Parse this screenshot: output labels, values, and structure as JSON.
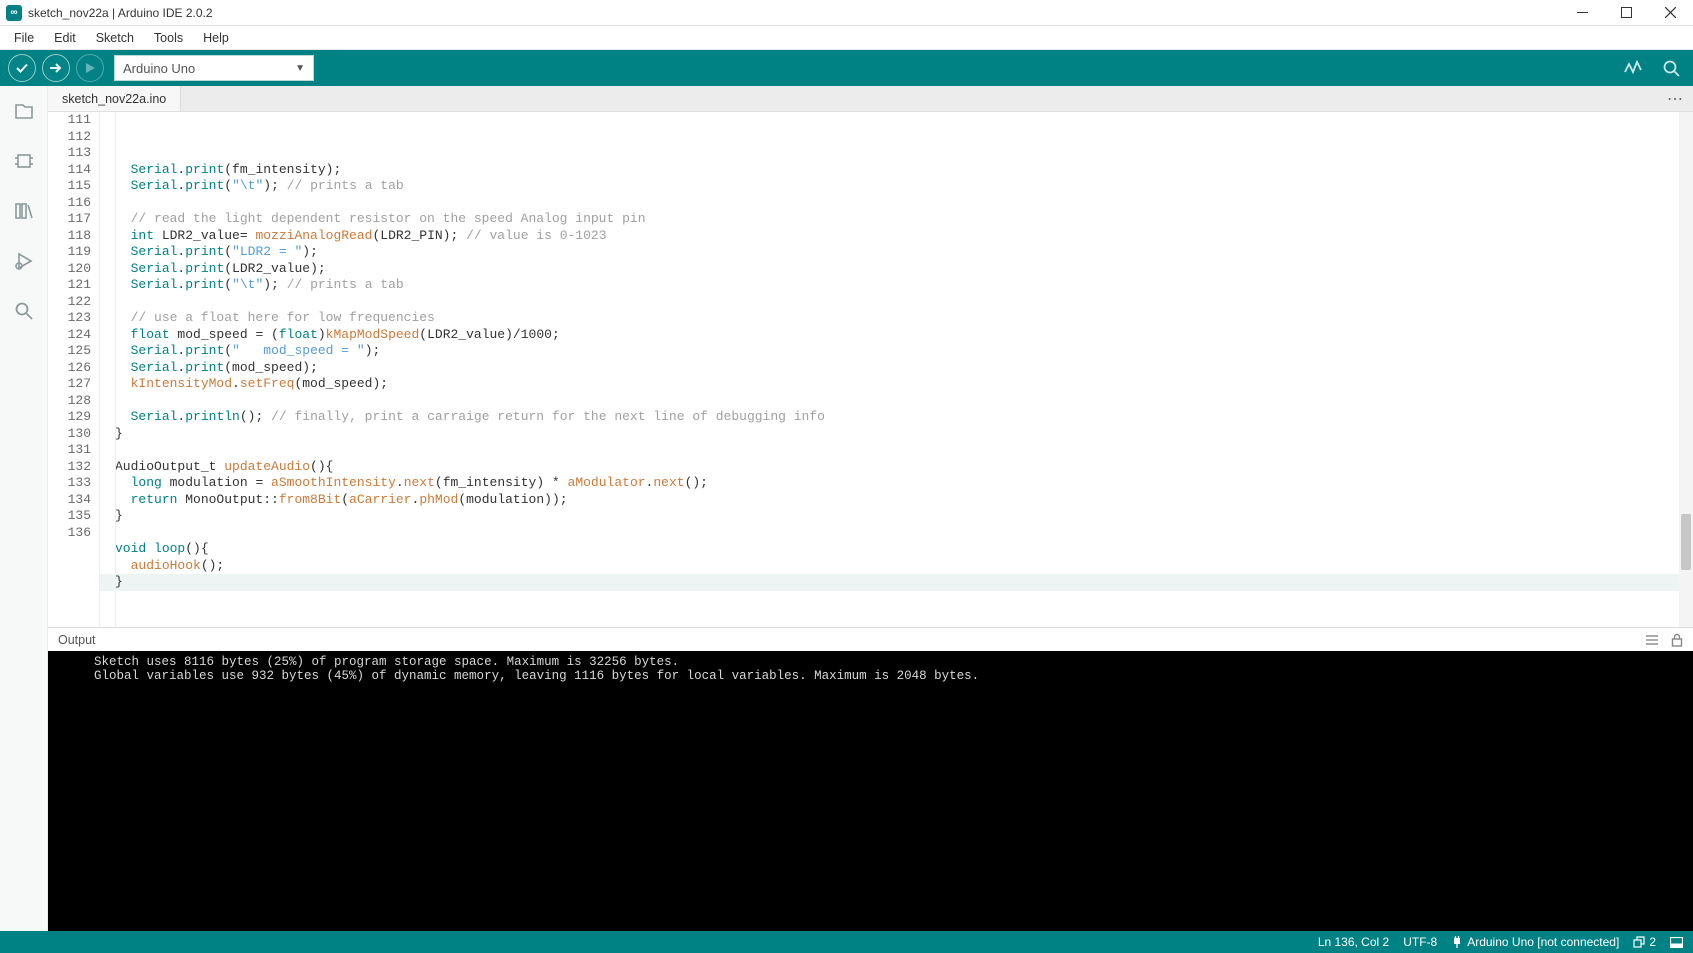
{
  "window": {
    "title": "sketch_nov22a | Arduino IDE 2.0.2",
    "app_icon_char": "∞"
  },
  "menubar": [
    "File",
    "Edit",
    "Sketch",
    "Tools",
    "Help"
  ],
  "toolbar": {
    "board_label": "Arduino Uno"
  },
  "tab": {
    "filename": "sketch_nov22a.ino"
  },
  "editor": {
    "first_line": 111,
    "lines": [
      [
        [
          "k1",
          "Serial"
        ],
        [
          ".",
          "."
        ],
        [
          "k1",
          "print"
        ],
        [
          "",
          "(fm_intensity);"
        ]
      ],
      [
        [
          "k1",
          "Serial"
        ],
        [
          ".",
          "."
        ],
        [
          "k1",
          "print"
        ],
        [
          "",
          "("
        ],
        [
          "k3",
          "\"\\t\""
        ],
        [
          "",
          ");"
        ],
        [
          "",
          " "
        ],
        [
          "cm",
          "// prints a tab"
        ]
      ],
      [],
      [
        [
          "cm",
          "// read the light dependent resistor on the speed Analog input pin"
        ]
      ],
      [
        [
          "k1",
          "int"
        ],
        [
          "",
          " LDR2_value= "
        ],
        [
          "k2",
          "mozziAnalogRead"
        ],
        [
          "",
          "(LDR2_PIN); "
        ],
        [
          "cm",
          "// value is 0-1023"
        ]
      ],
      [
        [
          "k1",
          "Serial"
        ],
        [
          ".",
          "."
        ],
        [
          "k1",
          "print"
        ],
        [
          "",
          "("
        ],
        [
          "k3",
          "\"LDR2 = \""
        ],
        [
          "",
          ");"
        ]
      ],
      [
        [
          "k1",
          "Serial"
        ],
        [
          ".",
          "."
        ],
        [
          "k1",
          "print"
        ],
        [
          "",
          "(LDR2_value);"
        ]
      ],
      [
        [
          "k1",
          "Serial"
        ],
        [
          ".",
          "."
        ],
        [
          "k1",
          "print"
        ],
        [
          "",
          "("
        ],
        [
          "k3",
          "\"\\t\""
        ],
        [
          "",
          ");"
        ],
        [
          "",
          " "
        ],
        [
          "cm",
          "// prints a tab"
        ]
      ],
      [],
      [
        [
          "cm",
          "// use a float here for low frequencies"
        ]
      ],
      [
        [
          "k1",
          "float"
        ],
        [
          "",
          " mod_speed = ("
        ],
        [
          "k1",
          "float"
        ],
        [
          "",
          ")"
        ],
        [
          "k2",
          "kMapModSpeed"
        ],
        [
          "",
          "(LDR2_value)/"
        ],
        [
          "num",
          "1000"
        ],
        [
          "",
          ";"
        ]
      ],
      [
        [
          "k1",
          "Serial"
        ],
        [
          ".",
          "."
        ],
        [
          "k1",
          "print"
        ],
        [
          "",
          "("
        ],
        [
          "k3",
          "\"   mod_speed = \""
        ],
        [
          "",
          ");"
        ]
      ],
      [
        [
          "k1",
          "Serial"
        ],
        [
          ".",
          "."
        ],
        [
          "k1",
          "print"
        ],
        [
          "",
          "(mod_speed);"
        ]
      ],
      [
        [
          "k2",
          "kIntensityMod"
        ],
        [
          ".",
          "."
        ],
        [
          "k2",
          "setFreq"
        ],
        [
          "",
          "(mod_speed);"
        ]
      ],
      [],
      [
        [
          "k1",
          "Serial"
        ],
        [
          ".",
          "."
        ],
        [
          "k1",
          "println"
        ],
        [
          "",
          "(); "
        ],
        [
          "cm",
          "// finally, print a carraige return for the next line of debugging info"
        ]
      ],
      [
        [
          "",
          "}"
        ]
      ],
      [],
      [
        [
          "",
          "AudioOutput_t "
        ],
        [
          "k2",
          "updateAudio"
        ],
        [
          "",
          "(){"
        ]
      ],
      [
        [
          "k1",
          "long"
        ],
        [
          "",
          " modulation = "
        ],
        [
          "k2",
          "aSmoothIntensity"
        ],
        [
          ".",
          "."
        ],
        [
          "k2",
          "next"
        ],
        [
          "",
          "(fm_intensity) * "
        ],
        [
          "k2",
          "aModulator"
        ],
        [
          ".",
          "."
        ],
        [
          "k2",
          "next"
        ],
        [
          "",
          "();"
        ]
      ],
      [
        [
          "k1",
          "return"
        ],
        [
          "",
          " MonoOutput::"
        ],
        [
          "k2",
          "from8Bit"
        ],
        [
          "",
          "("
        ],
        [
          "k2",
          "aCarrier"
        ],
        [
          ".",
          "."
        ],
        [
          "k2",
          "phMod"
        ],
        [
          "",
          "(modulation));"
        ]
      ],
      [
        [
          "",
          "}"
        ]
      ],
      [],
      [
        [
          "k1",
          "void"
        ],
        [
          "",
          " "
        ],
        [
          "k1",
          "loop"
        ],
        [
          "",
          "(){"
        ]
      ],
      [
        [
          "k2",
          "audioHook"
        ],
        [
          "",
          "();"
        ]
      ],
      [
        [
          "",
          "}"
        ]
      ]
    ],
    "indents": [
      2,
      2,
      0,
      2,
      2,
      2,
      2,
      2,
      0,
      2,
      2,
      2,
      2,
      2,
      0,
      2,
      0,
      0,
      0,
      2,
      2,
      0,
      0,
      0,
      2,
      0
    ],
    "scroll_thumb": {
      "top_pct": 78,
      "height_pct": 11
    }
  },
  "output": {
    "label": "Output",
    "lines": [
      "Sketch uses 8116 bytes (25%) of program storage space. Maximum is 32256 bytes.",
      "Global variables use 932 bytes (45%) of dynamic memory, leaving 1116 bytes for local variables. Maximum is 2048 bytes."
    ]
  },
  "statusbar": {
    "ln_col": "Ln 136, Col 2",
    "encoding": "UTF-8",
    "board": "Arduino Uno [not connected]",
    "notifications": "2"
  }
}
